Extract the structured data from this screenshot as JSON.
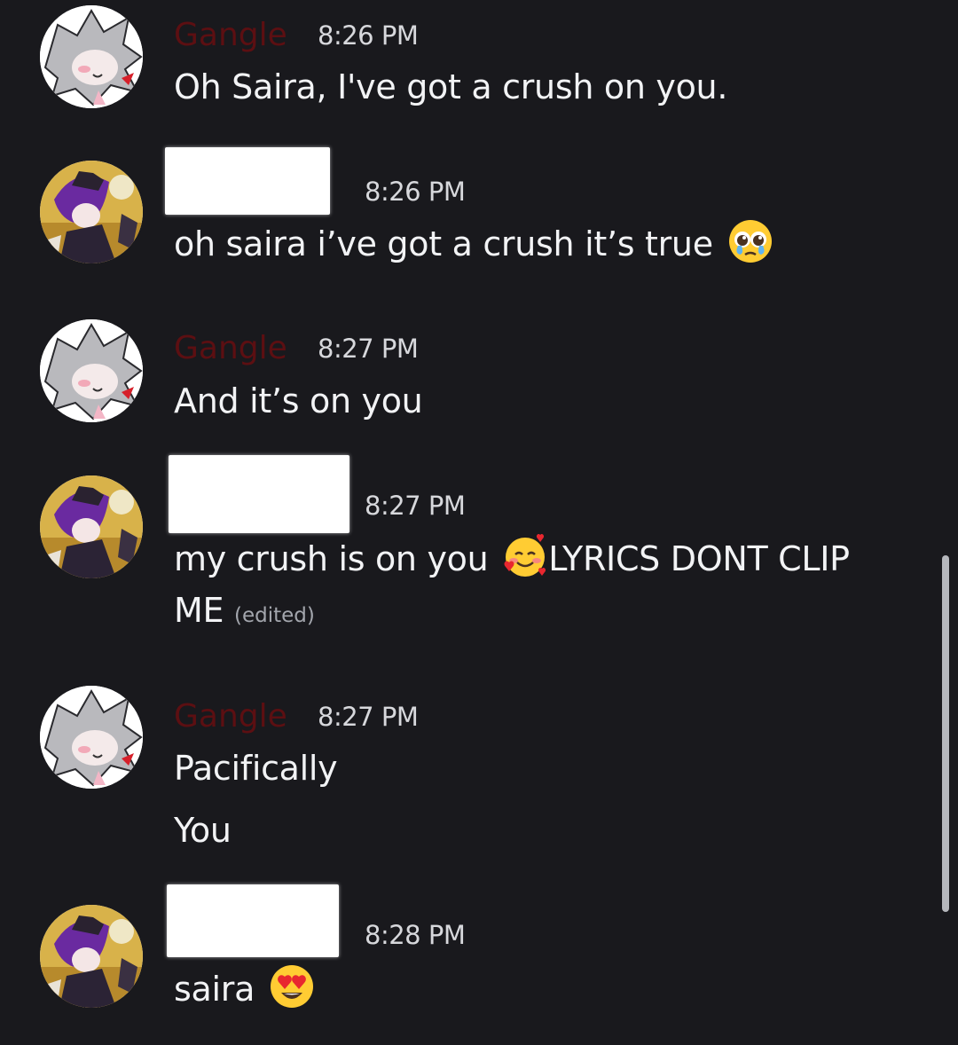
{
  "messages": [
    {
      "username": "Gangle",
      "time": "8:26 PM",
      "lines": [
        "Oh Saira, I've got a crush on you."
      ]
    },
    {
      "username": "",
      "time": "8:26 PM",
      "lines": [
        "oh saira i’ve got a crush it’s true"
      ],
      "emoji": "pleading-face-icon"
    },
    {
      "username": "Gangle",
      "time": "8:27 PM",
      "lines": [
        "And it’s on you"
      ]
    },
    {
      "username": "",
      "time": "8:27 PM",
      "lines": [
        "my crush is on you",
        "LYRICS DONT CLIP",
        "ME"
      ],
      "emoji": "smiling-face-with-hearts-icon",
      "edited": "(edited)"
    },
    {
      "username": "Gangle",
      "time": "8:27 PM",
      "lines": [
        "Pacifically",
        "You"
      ]
    },
    {
      "username": "",
      "time": "8:28 PM",
      "lines": [
        "saira"
      ],
      "emoji": "heart-eyes-icon"
    }
  ],
  "colors": {
    "background": "#19191d",
    "username_gangle": "#5c0f12",
    "message_text": "#f2f3f5",
    "timestamp": "#d7d8dc",
    "edited": "#a3a6ad",
    "scrollbar": "#b5b7bc"
  }
}
